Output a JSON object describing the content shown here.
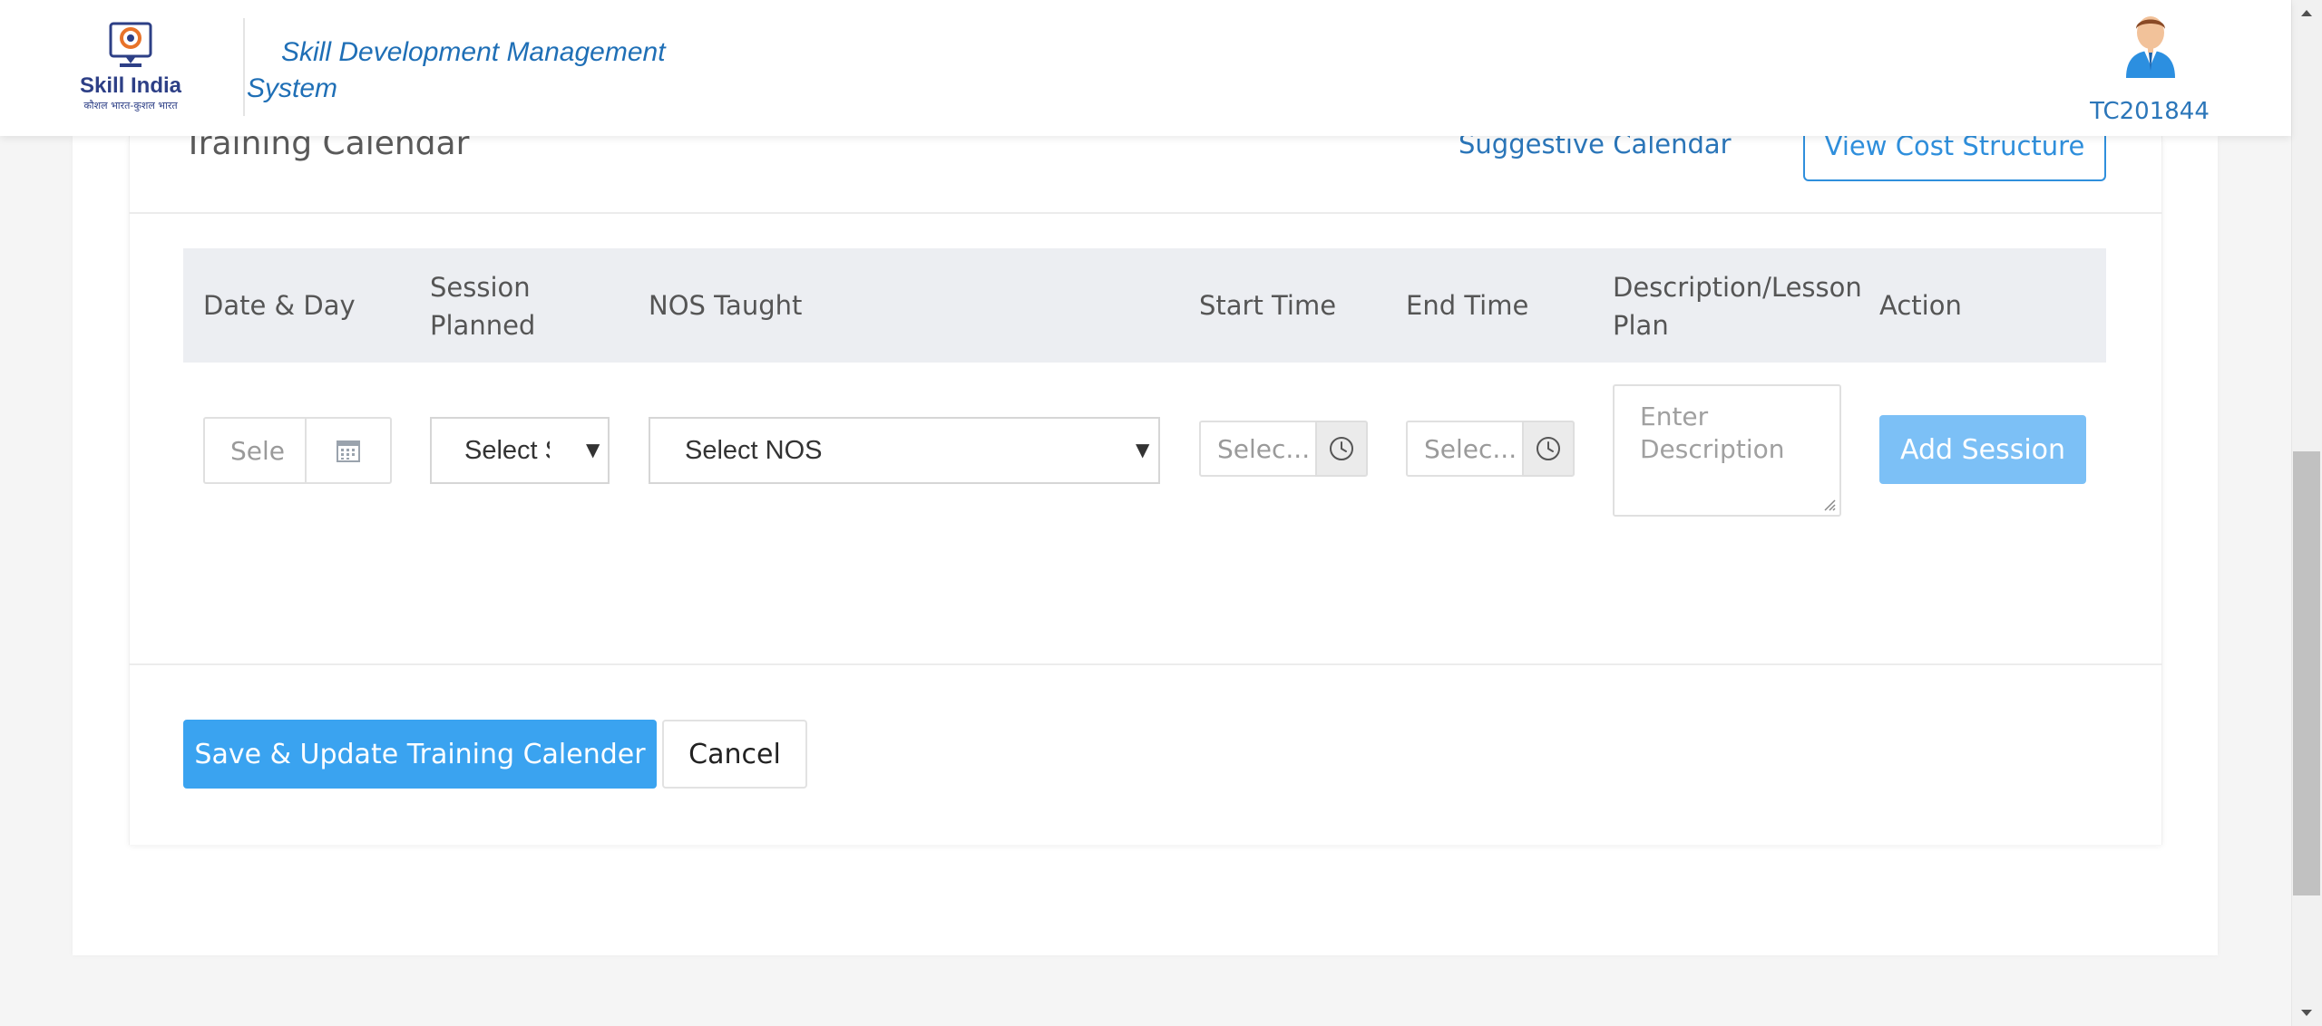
{
  "header": {
    "app_title": "Skill Development Management System",
    "user_id": "TC201844",
    "logo_icon": "skill-india-logo",
    "avatar_icon": "user-avatar-icon"
  },
  "calendar": {
    "title": "Training Calendar",
    "suggestive_link": "Suggestive Calendar",
    "cost_button": "View Cost Structure"
  },
  "table": {
    "columns": [
      "Date & Day",
      "Session Planned",
      "NOS Taught",
      "Start Time",
      "End Time",
      "Description/Lesson Plan",
      "Action"
    ],
    "row": {
      "date_placeholder": "Sele",
      "session_select": "Select S",
      "nos_select": "Select NOS",
      "start_time_placeholder": "Selec...",
      "end_time_placeholder": "Selec...",
      "description_placeholder": "Enter Description",
      "add_button": "Add Session"
    }
  },
  "footer": {
    "save_button": "Save & Update Training Calender",
    "cancel_button": "Cancel"
  },
  "colors": {
    "primary": "#3aa3f0",
    "primary_light": "#7cc0f6",
    "link": "#2b76b9",
    "table_header_bg": "#eceef2"
  }
}
